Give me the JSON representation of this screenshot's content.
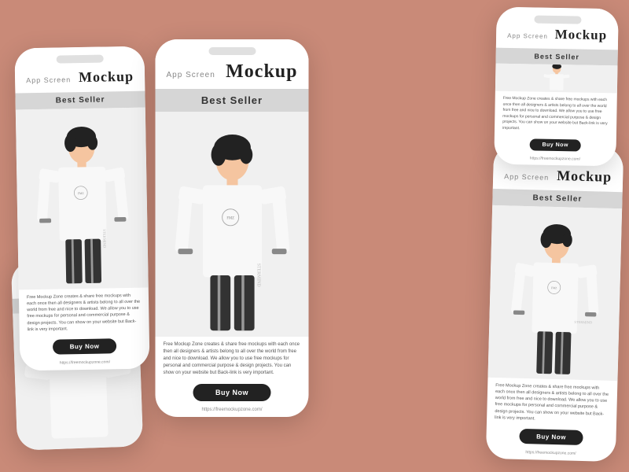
{
  "background": "#c98a78",
  "cards": {
    "app_screen_label": "App Screen",
    "mockup_title": "Mockup",
    "best_seller": "Best Seller",
    "description": "Free Mockup Zone creates & share free mockups with each once then all designers & artists belong to all over the world from free and nice to download. We allow you to use free mockups for personal and commercial purpose & design projects. You can show on your website but Back-link is very important.",
    "buy_button": "Buy Now",
    "url": "https://freemockupzone.com/",
    "shirt_logo": "Free Mockup Zone",
    "vertical_text": "STERMIND"
  }
}
